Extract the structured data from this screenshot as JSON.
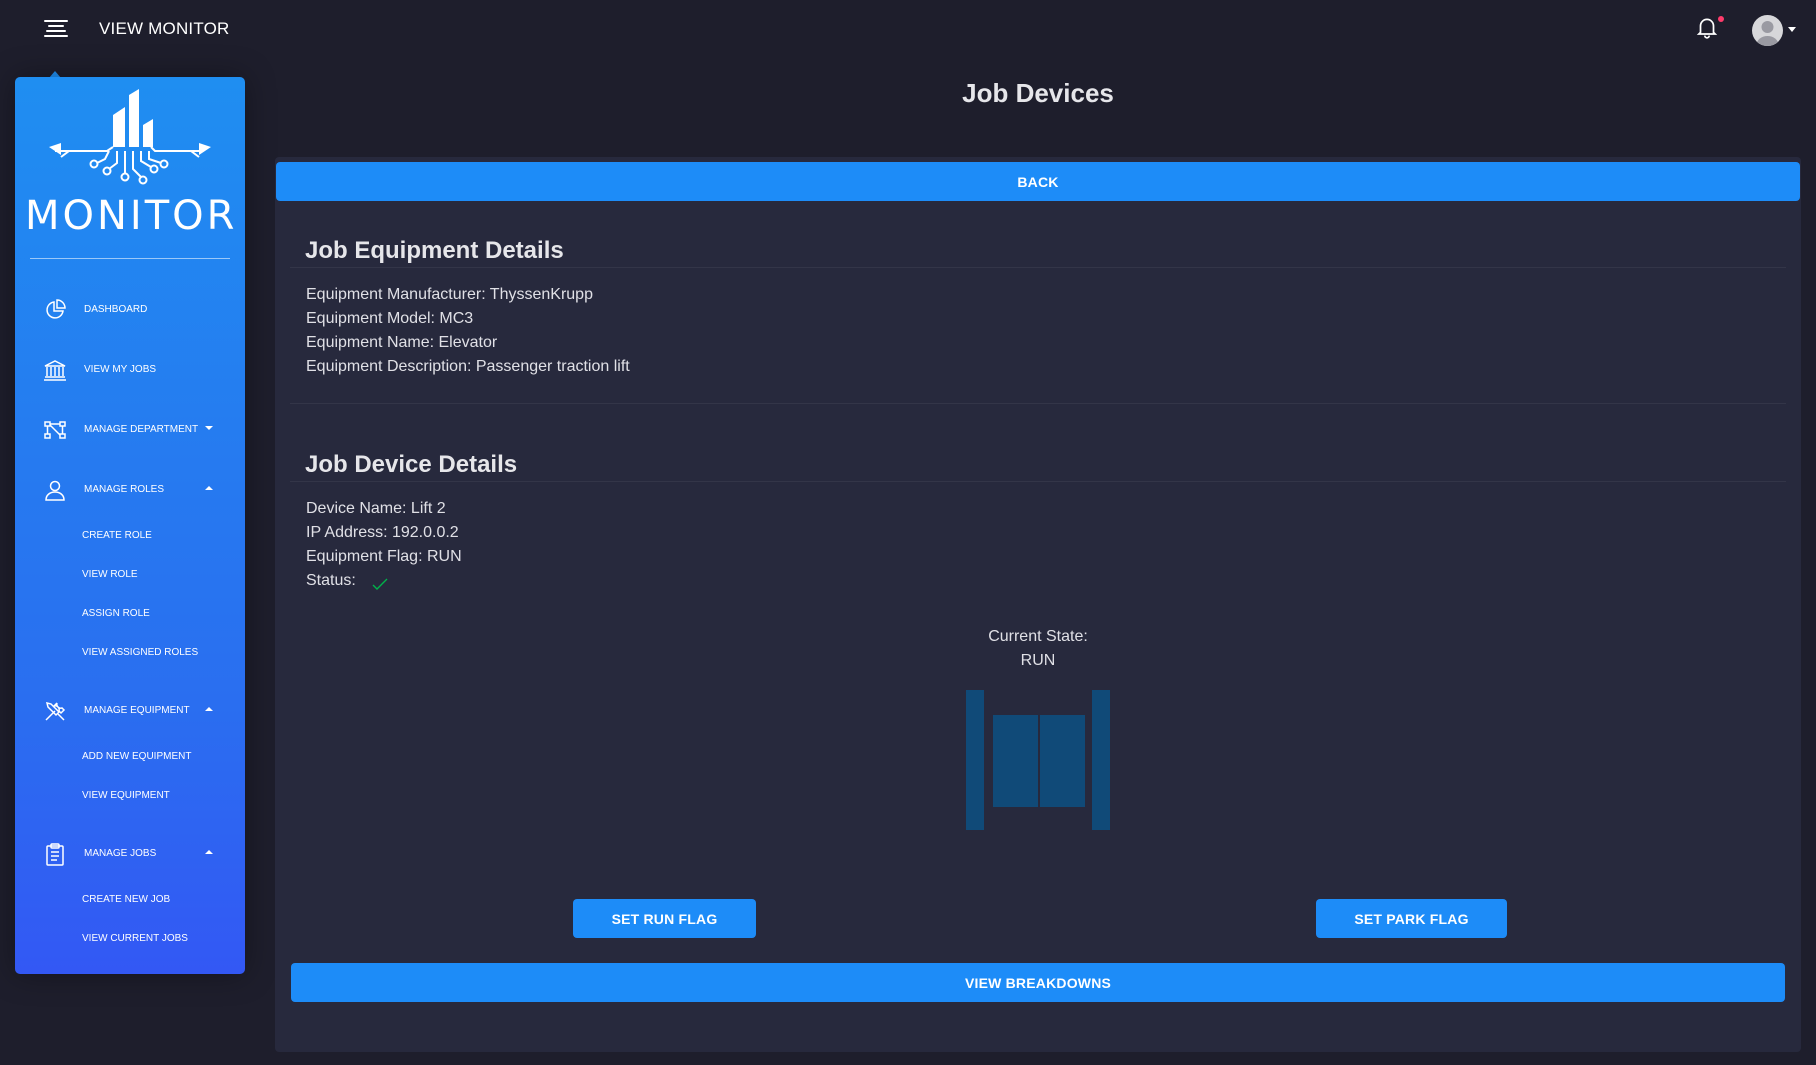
{
  "header": {
    "app_title": "VIEW MONITOR",
    "menu_icon": "hamburger-icon",
    "notification_icon": "bell-icon",
    "avatar_icon": "user-avatar-icon"
  },
  "sidebar": {
    "logo_text": "MONITOR",
    "items": [
      {
        "label": "DASHBOARD",
        "icon": "pie-chart-icon"
      },
      {
        "label": "VIEW MY JOBS",
        "icon": "bank-icon"
      },
      {
        "label": "MANAGE DEPARTMENT",
        "icon": "network-icon"
      },
      {
        "label": "MANAGE ROLES",
        "icon": "user-icon",
        "children": [
          "CREATE ROLE",
          "VIEW ROLE",
          "ASSIGN ROLE",
          "VIEW ASSIGNED ROLES"
        ]
      },
      {
        "label": "MANAGE EQUIPMENT",
        "icon": "tools-icon",
        "children": [
          "ADD NEW EQUIPMENT",
          "VIEW EQUIPMENT"
        ]
      },
      {
        "label": "MANAGE JOBS",
        "icon": "clipboard-icon",
        "children": [
          "CREATE NEW JOB",
          "VIEW CURRENT JOBS"
        ]
      }
    ]
  },
  "main": {
    "title": "Job Devices",
    "back_label": "BACK",
    "equipment": {
      "heading": "Job Equipment Details",
      "lines": [
        "Equipment Manufacturer: ThyssenKrupp",
        "Equipment Model: MC3",
        "Equipment Name: Elevator",
        "Equipment Description: Passenger traction lift"
      ]
    },
    "device": {
      "heading": "Job Device Details",
      "lines": [
        "Device Name: Lift 2",
        "IP Address: 192.0.0.2",
        "Equipment Flag: RUN",
        "Status:"
      ],
      "status_icon": "check-icon",
      "current_state_label": "Current State:",
      "current_state_value": "RUN",
      "lift_icon": "elevator-doors-icon"
    },
    "set_run_label": "SET RUN FLAG",
    "set_park_label": "SET PARK FLAG",
    "view_breakdowns_label": "VIEW BREAKDOWNS"
  },
  "colors": {
    "background": "#1e1e2c",
    "panel": "#27293d",
    "accent": "#1d8cf8",
    "sidebar_top": "#1f8ef1",
    "sidebar_bottom": "#3358f4",
    "lift": "#104a78",
    "status_ok": "#00b34a"
  }
}
